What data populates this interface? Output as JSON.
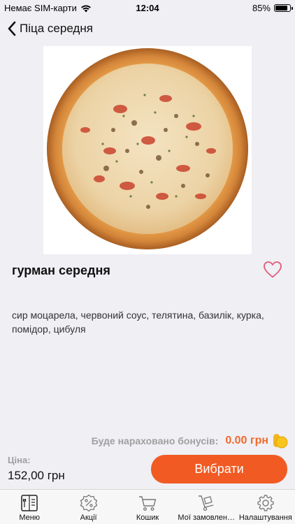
{
  "status_bar": {
    "carrier": "Немає SIM-карти",
    "time": "12:04",
    "battery": "85%",
    "battery_level": 0.85
  },
  "nav": {
    "back_title": "Піца середня"
  },
  "product": {
    "name": "гурман середня",
    "description": "сир моцарела, червоний соус, телятина, базилік, курка, помідор, цибуля"
  },
  "bonus": {
    "label": "Буде нараховано бонусів:",
    "value": "0.00 грн"
  },
  "price": {
    "label": "Ціна:",
    "value": "152,00 грн"
  },
  "actions": {
    "select_label": "Вибрати"
  },
  "colors": {
    "accent": "#f15a22",
    "bonus_text": "#f26a2c",
    "muted_text": "#a0a0a0",
    "background": "#efeff4"
  },
  "tabs": [
    {
      "label": "Меню",
      "icon": "menu-book-icon"
    },
    {
      "label": "Акції",
      "icon": "discount-badge-icon"
    },
    {
      "label": "Кошик",
      "icon": "cart-icon"
    },
    {
      "label": "Мої замовлення",
      "icon": "hand-truck-icon"
    },
    {
      "label": "Налаштування",
      "icon": "gear-icon"
    }
  ]
}
